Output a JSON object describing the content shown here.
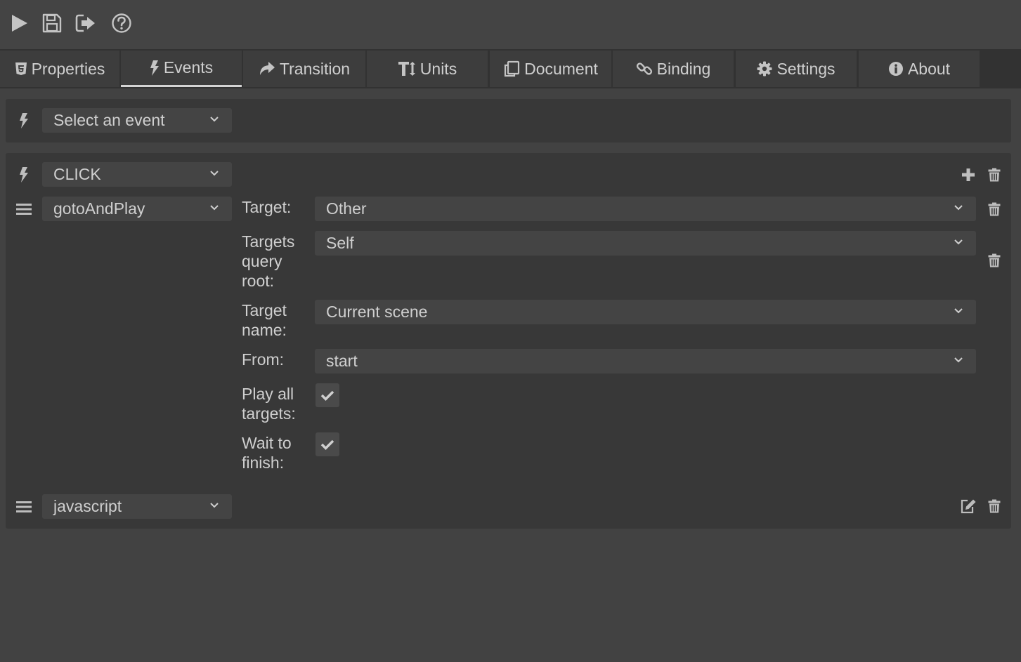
{
  "toolbar": {
    "buttons": [
      {
        "icon": "play-icon"
      },
      {
        "icon": "save-icon"
      },
      {
        "icon": "exit-icon"
      },
      {
        "icon": "help-icon"
      }
    ]
  },
  "tabs": [
    {
      "label": "Properties",
      "icon": "html5-icon"
    },
    {
      "label": "Events",
      "icon": "bolt-icon",
      "active": true
    },
    {
      "label": "Transition",
      "icon": "share-arrow-icon"
    },
    {
      "label": "Units",
      "icon": "text-height-icon"
    },
    {
      "label": "Document",
      "icon": "copy-icon"
    },
    {
      "label": "Binding",
      "icon": "link-icon"
    },
    {
      "label": "Settings",
      "icon": "gear-icon"
    },
    {
      "label": "About",
      "icon": "info-icon"
    }
  ],
  "event_selector": {
    "value": "Select an event"
  },
  "event_block": {
    "event": "CLICK",
    "action1": {
      "name": "gotoAndPlay",
      "fields": {
        "target_label": "Target:",
        "target_value": "Other",
        "targets_query_root_label": "Targets query root:",
        "targets_query_root_value": "Self",
        "target_name_label": "Target name:",
        "target_name_value": "Current scene",
        "from_label": "From:",
        "from_value": "start",
        "play_all_targets_label": "Play all targets:",
        "play_all_targets_checked": true,
        "wait_to_finish_label": "Wait to finish:",
        "wait_to_finish_checked": true
      }
    },
    "action2": {
      "name": "javascript"
    }
  },
  "colors": {
    "background": "#424242",
    "panel": "#383838",
    "control": "#444444",
    "tab_bar": "#323232",
    "tab": "#3d3d3d",
    "text": "#cfcfcf",
    "icon": "#bdbdbd"
  }
}
